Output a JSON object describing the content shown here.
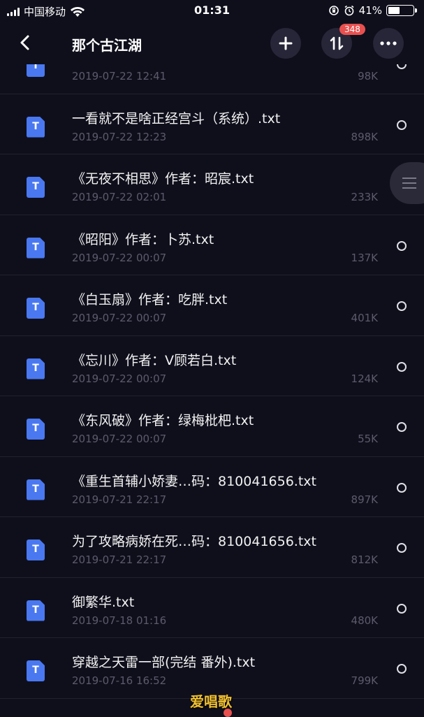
{
  "status_bar": {
    "carrier": "中国移动",
    "time": "01:31",
    "battery": "41%"
  },
  "nav": {
    "title": "那个古江湖",
    "badge": "348"
  },
  "files": [
    {
      "name": "",
      "date": "2019-07-22 12:41",
      "size": "98K"
    },
    {
      "name": "一看就不是啥正经宫斗（系统）.txt",
      "date": "2019-07-22 12:23",
      "size": "898K"
    },
    {
      "name": "《无夜不相思》作者：昭宸.txt",
      "date": "2019-07-22 02:01",
      "size": "233K"
    },
    {
      "name": "《昭阳》作者：卜苏.txt",
      "date": "2019-07-22 00:07",
      "size": "137K"
    },
    {
      "name": "《白玉扇》作者：吃胖.txt",
      "date": "2019-07-22 00:07",
      "size": "401K"
    },
    {
      "name": "《忘川》作者：V顾若白.txt",
      "date": "2019-07-22 00:07",
      "size": "124K"
    },
    {
      "name": "《东风破》作者：绿梅枇杷.txt",
      "date": "2019-07-22 00:07",
      "size": "55K"
    },
    {
      "name": "《重生首辅小娇妻…码：810041656.txt",
      "date": "2019-07-21 22:17",
      "size": "897K"
    },
    {
      "name": "为了攻略病娇在死…码：810041656.txt",
      "date": "2019-07-21 22:17",
      "size": "812K"
    },
    {
      "name": "御繁华.txt",
      "date": "2019-07-18 01:16",
      "size": "480K"
    },
    {
      "name": "穿越之天雷一部(完结 番外).txt",
      "date": "2019-07-16 16:52",
      "size": "799K"
    }
  ],
  "watermark": "爱唱歌"
}
